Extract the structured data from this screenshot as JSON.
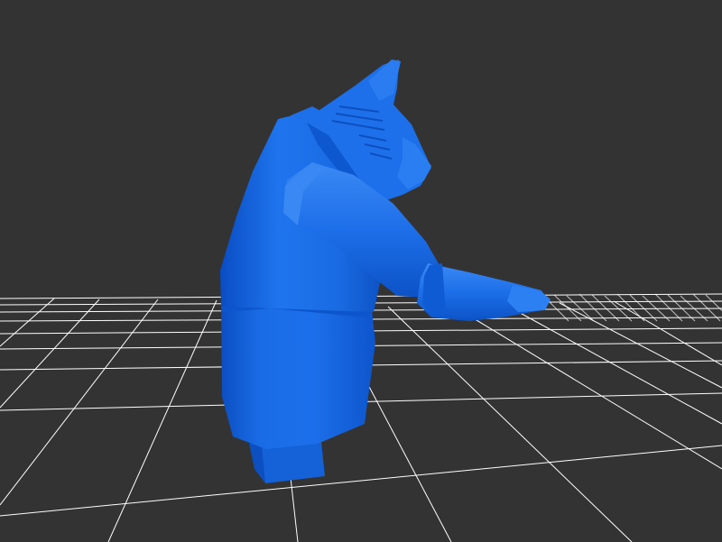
{
  "viewer": {
    "background_color": "#333333",
    "grid_color": "#ffffff",
    "model_color": "#1a6fe8",
    "model_shadow_color": "#0b4fc0",
    "model_highlight_color": "#3f8cf5",
    "model_icon": "cat-figure-3d-model"
  }
}
